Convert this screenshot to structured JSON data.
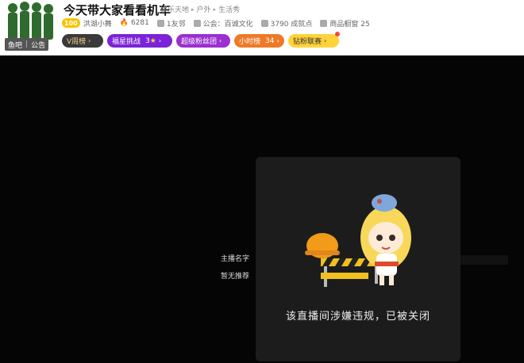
{
  "header": {
    "title": "今天带大家看看机车",
    "breadcrumb": [
      "娱乐天地",
      "户外",
      "生活秀"
    ],
    "avatar_tabs": [
      "鱼吧",
      "公告"
    ],
    "meta": {
      "level": "100",
      "anchor_name": "洪湖小舞",
      "heat": "6281",
      "friends": "1友邻",
      "notice_label": "公会：",
      "notice_value": "百诚文化",
      "achievement": "3790 成就点",
      "showcase": "商品橱窗 25"
    },
    "badges": {
      "vweek": "V周榜",
      "star_challenge": "福星挑战",
      "star_count": "3",
      "super_fan": "超级粉丝团",
      "hour_rank": "小时榜",
      "hour_rank_value": "34",
      "diamond_fan": "钻粉联赛"
    }
  },
  "player": {
    "side_labels": {
      "anchor_name": "主播名字",
      "no_recommend": "暂无推荐"
    },
    "closed_message": "该直播间涉嫌违规，已被关闭"
  },
  "colors": {
    "star_badge": "#7b23d8",
    "fan_badge": "#9b2fd0",
    "hour_badge": "#ee7a28",
    "diamond_badge": "#ffd33a",
    "level_badge": "#f7c300"
  }
}
